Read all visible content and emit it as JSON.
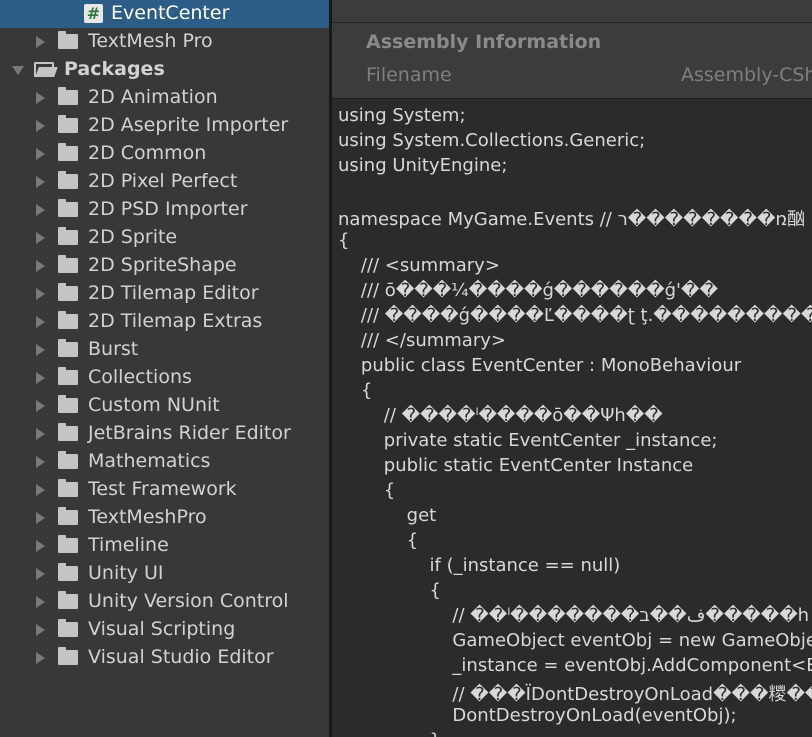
{
  "project_tree": {
    "items": [
      {
        "label": "EventCenter",
        "kind": "script",
        "selected": true,
        "level": 2,
        "expandable": false
      },
      {
        "label": "TextMesh Pro",
        "kind": "folder",
        "selected": false,
        "level": 1,
        "expandable": true
      },
      {
        "label": "Packages",
        "kind": "folder-open",
        "selected": false,
        "level": 0,
        "expandable": true,
        "bold": true
      },
      {
        "label": "2D Animation",
        "kind": "folder",
        "level": 1,
        "expandable": true
      },
      {
        "label": "2D Aseprite Importer",
        "kind": "folder",
        "level": 1,
        "expandable": true
      },
      {
        "label": "2D Common",
        "kind": "folder",
        "level": 1,
        "expandable": true
      },
      {
        "label": "2D Pixel Perfect",
        "kind": "folder",
        "level": 1,
        "expandable": true
      },
      {
        "label": "2D PSD Importer",
        "kind": "folder",
        "level": 1,
        "expandable": true
      },
      {
        "label": "2D Sprite",
        "kind": "folder",
        "level": 1,
        "expandable": true
      },
      {
        "label": "2D SpriteShape",
        "kind": "folder",
        "level": 1,
        "expandable": true
      },
      {
        "label": "2D Tilemap Editor",
        "kind": "folder",
        "level": 1,
        "expandable": true
      },
      {
        "label": "2D Tilemap Extras",
        "kind": "folder",
        "level": 1,
        "expandable": true
      },
      {
        "label": "Burst",
        "kind": "folder",
        "level": 1,
        "expandable": true
      },
      {
        "label": "Collections",
        "kind": "folder",
        "level": 1,
        "expandable": true
      },
      {
        "label": "Custom NUnit",
        "kind": "folder",
        "level": 1,
        "expandable": true
      },
      {
        "label": "JetBrains Rider Editor",
        "kind": "folder",
        "level": 1,
        "expandable": true
      },
      {
        "label": "Mathematics",
        "kind": "folder",
        "level": 1,
        "expandable": true
      },
      {
        "label": "Test Framework",
        "kind": "folder",
        "level": 1,
        "expandable": true
      },
      {
        "label": "TextMeshPro",
        "kind": "folder",
        "level": 1,
        "expandable": true
      },
      {
        "label": "Timeline",
        "kind": "folder",
        "level": 1,
        "expandable": true
      },
      {
        "label": "Unity UI",
        "kind": "folder",
        "level": 1,
        "expandable": true
      },
      {
        "label": "Unity Version Control",
        "kind": "folder",
        "level": 1,
        "expandable": true
      },
      {
        "label": "Visual Scripting",
        "kind": "folder",
        "level": 1,
        "expandable": true
      },
      {
        "label": "Visual Studio Editor",
        "kind": "folder",
        "level": 1,
        "expandable": true
      }
    ]
  },
  "inspector": {
    "section_title": "Assembly Information",
    "filename_label": "Filename",
    "filename_value": "Assembly-CSharp.dll",
    "code_lines": [
      "using System;",
      "using System.Collections.Generic;",
      "using UnityEngine;",
      "",
      "namespace MyGame.Events // ר��������ռ酗",
      "{",
      "    /// <summary>",
      "    /// ō���¼����ǵ������ǵ'��",
      "    /// ����ǵ����Ľ����ʈ ţ.�����������",
      "    /// </summary>",
      "    public class EventCenter : MonoBehaviour",
      "    {",
      "        // ����ˡ����ō��Ψh��",
      "        private static EventCenter _instance;",
      "        public static EventCenter Instance",
      "        {",
      "            get",
      "            {",
      "                if (_instance == null)",
      "                {",
      "                    // ��ˡ�������ف��ב�����h",
      "                    GameObject eventObj = new GameObject(\"EventCenter\");",
      "                    _instance = eventObj.AddComponent<EventCenter>();",
      "                    // ���ÏDontDestroyOnLoad���糭��",
      "                    DontDestroyOnLoad(eventObj);",
      "                }"
    ]
  }
}
